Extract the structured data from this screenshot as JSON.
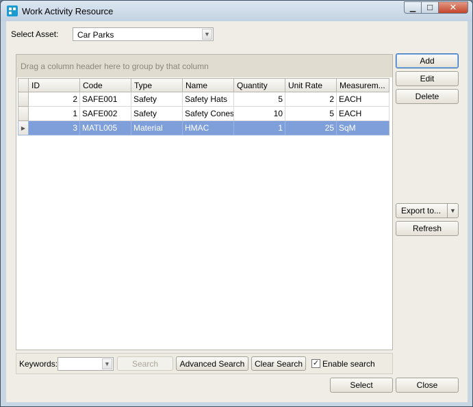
{
  "window": {
    "title": "Work Activity Resource"
  },
  "caption": {
    "minimize": "▁",
    "maximize": "☐",
    "close": "✕"
  },
  "asset": {
    "label": "Select Asset:",
    "value": "Car Parks"
  },
  "grid": {
    "group_hint": "Drag a column header here to group by that column",
    "columns": [
      "ID",
      "Code",
      "Type",
      "Name",
      "Quantity",
      "Unit Rate",
      "Measurem..."
    ],
    "rows": [
      {
        "id": "2",
        "code": "SAFE001",
        "type": "Safety",
        "name": "Safety Hats",
        "quantity": "5",
        "unit_rate": "2",
        "measurement": "EACH"
      },
      {
        "id": "1",
        "code": "SAFE002",
        "type": "Safety",
        "name": "Safety Cones",
        "quantity": "10",
        "unit_rate": "5",
        "measurement": "EACH"
      },
      {
        "id": "3",
        "code": "MATL005",
        "type": "Material",
        "name": "HMAC",
        "quantity": "1",
        "unit_rate": "25",
        "measurement": "SqM"
      }
    ],
    "selected_row_marker": "▶"
  },
  "actions": {
    "add": "Add",
    "edit": "Edit",
    "delete": "Delete",
    "export": "Export to...",
    "refresh": "Refresh"
  },
  "search": {
    "keywords_label": "Keywords:",
    "keywords_value": "",
    "search_button": "Search",
    "advanced_button": "Advanced Search",
    "clear_button": "Clear Search",
    "enable_label": "Enable search",
    "enable_checked": true
  },
  "footer": {
    "select": "Select",
    "close": "Close"
  },
  "icons": {
    "dropdown": "chevron-down-icon",
    "app": "app-logo-icon",
    "check": "checkmark-icon",
    "row_pointer": "row-pointer-icon"
  },
  "colors": {
    "selection": "#7e9fd9",
    "window_background": "#f0ede6",
    "group_area": "#e1dcd0",
    "close_button": "#c3442a"
  }
}
